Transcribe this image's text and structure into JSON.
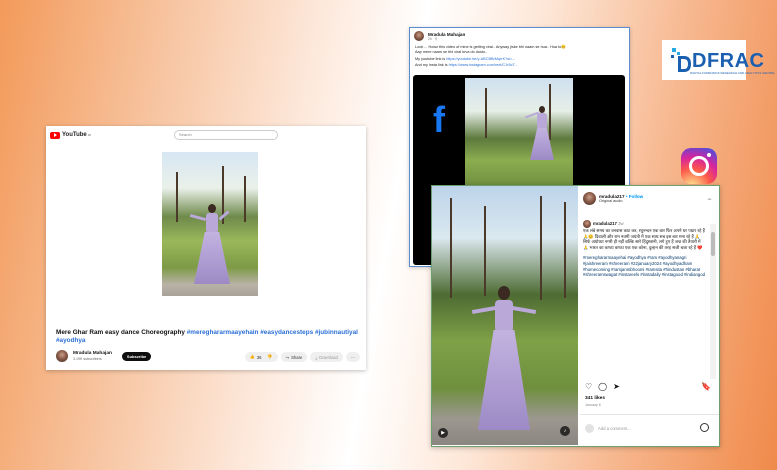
{
  "youtube": {
    "logo": "YouTube",
    "logo_sup": "IN",
    "search_placeholder": "Search",
    "title_prefix": "Mere Ghar Ram easy dance Choreography ",
    "title_tags": "#mereghararmaayehain #easydancesteps #jubinnautiyal #ayodhya",
    "channel_name": "Mradula Mahajan",
    "subscribers": "3.19K subscribers",
    "subscribe_label": "Subscribe",
    "like_count": "36",
    "share_label": "Share",
    "download_label": "Download",
    "more_label": "···"
  },
  "facebook": {
    "author": "Mradula Mahajan",
    "meta": "2h · ⚲",
    "line1": "Look ... Howz this video of mine is getting viral.. Anyway jiske bhi naam se hua.. Hua to😊",
    "line2": "Aap mere naam se bhi viral krva do dosto..",
    "yt_label": "My youtube link is ",
    "yt_link": "https://youtube.be/y-ABCBBrMqrrK?si=...",
    "insta_label": "And my insta link is ",
    "insta_link": "https://www.instagram.com/reel/C1r5cT...",
    "logo": "f"
  },
  "instagram": {
    "username": "mradula217",
    "follow_label": "• Follow",
    "audio": "Original audio",
    "more": "···",
    "cap_user": "mradula217",
    "cap_time": "3w",
    "caption": "एक लंबे समय का वनवास काट कर, रघुनन्दन एक बार फिर अपने घर पधार रहे हैं 🙏😊 दिवाली और राम नवमी जयंती में एक साथ सब इस बार मना रहे हैं 🙏 सिर्फ अयोध्या नगरी ही नहीं बल्कि सारे हिंदुस्तानी, लगे हुए हैं जश्न की तैयारी में 🙏 भारत का कण्ठा कण्ठा एक एक कोना, दुल्हन की तरह सजी बजा रहे हैं ❤️",
    "hashtags": "#mereghararmaayehai #ayodhya #ram #ayodhyanagri #jaishreeram #shreeram #22january2024 #ayodhyadham #homecoming #ramjanmbhoomi #ramsita #hindustan #bharat #shreeramswagat #instareels #instadaily #instagood #indiangod",
    "likes": "341 likes",
    "date": "January 6",
    "comment_placeholder": "Add a comment..."
  },
  "dfrac": {
    "name": "DFRAC",
    "subtitle": "DIGITAL FORENSICS RESEARCH AND ANALYTICS CENTRE"
  },
  "colors": {
    "youtube_red": "#ff0000",
    "facebook_blue": "#1877f2",
    "link_blue": "#2a6fd6",
    "dfrac_blue": "#1a5fb0"
  }
}
